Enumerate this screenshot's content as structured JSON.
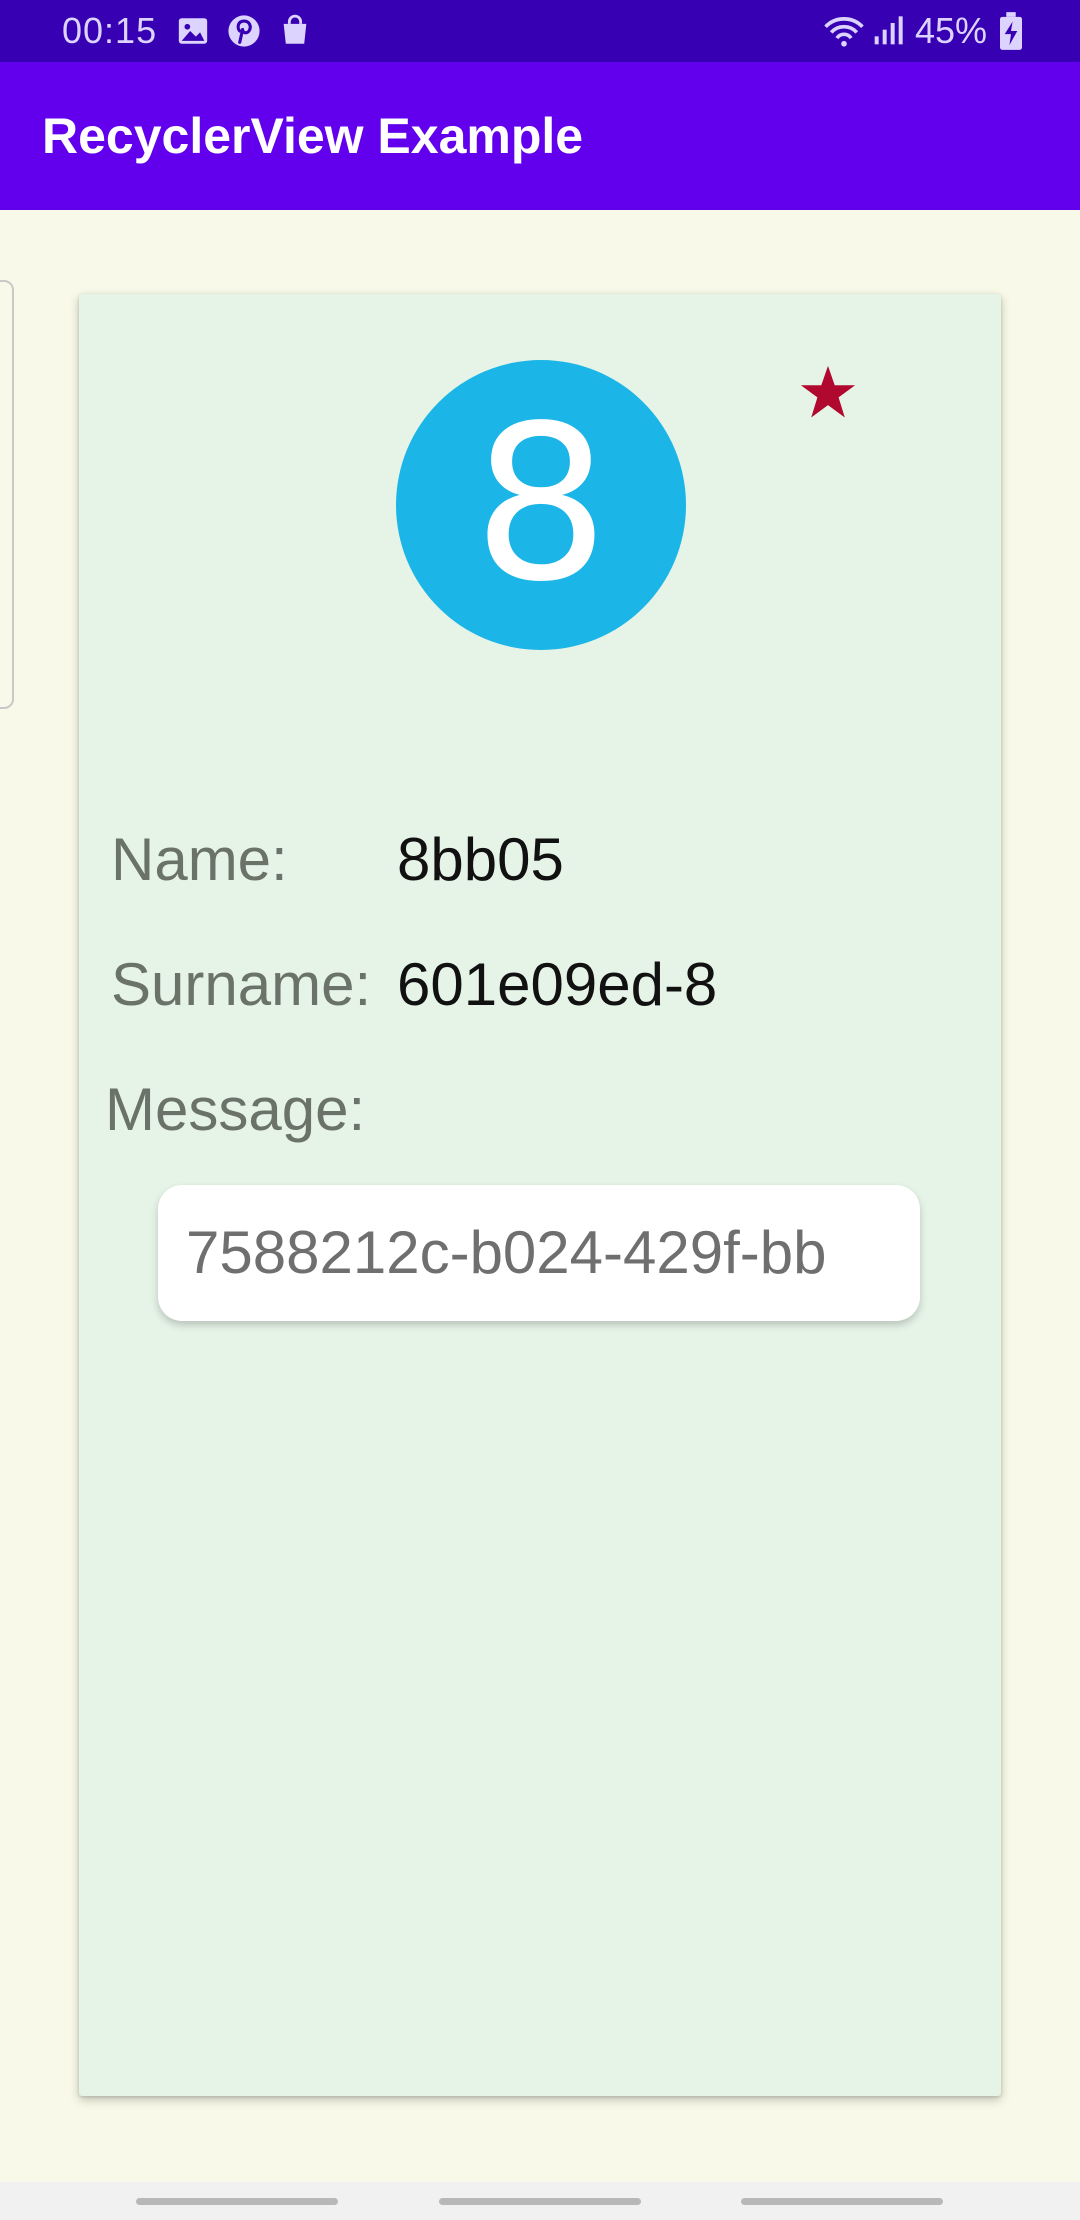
{
  "status_bar": {
    "time": "00:15",
    "left_icons": [
      "image-icon",
      "pinterest-icon",
      "shopping-bag-icon"
    ],
    "right_icons": [
      "wifi-icon",
      "signal-icon",
      "battery-charging-icon"
    ],
    "battery": "45%"
  },
  "app_bar": {
    "title": "RecyclerView Example",
    "color": "#6200ee"
  },
  "card": {
    "avatar_number": "8",
    "avatar_color": "#1cb5e7",
    "favorite_icon": "star-icon",
    "favorite_color": "#b0082e",
    "name_label": "Name:",
    "name_value": "8bb05",
    "surname_label": "Surname:",
    "surname_value": "601e09ed-8",
    "message_label": "Message:",
    "message_value": "7588212c-b024-429f-bb"
  }
}
